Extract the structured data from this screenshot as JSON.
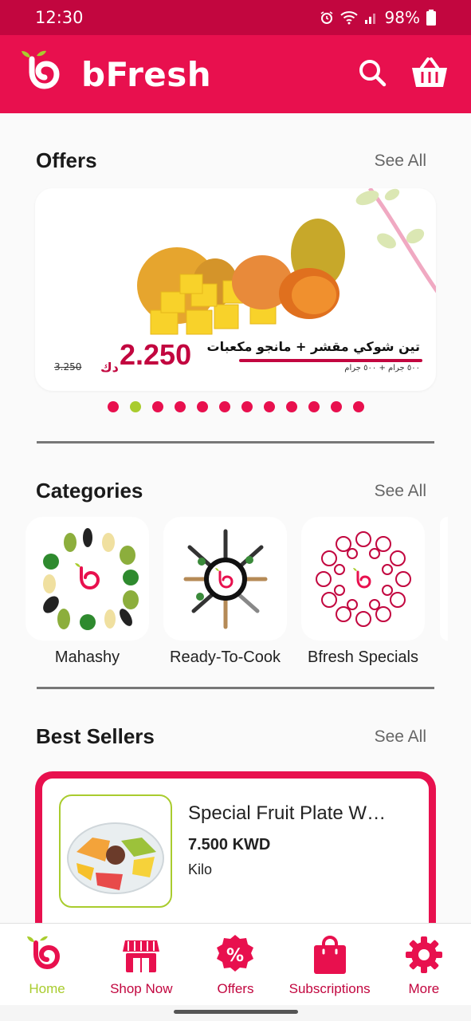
{
  "status_bar": {
    "time": "12:30",
    "battery": "98%"
  },
  "app_bar": {
    "brand_name": "bFresh",
    "search_icon": "search-icon",
    "cart_icon": "basket-icon"
  },
  "offers": {
    "title": "Offers",
    "see_all": "See All",
    "banner": {
      "title_ar": "تين شوكي مقشر + مانجو مكعبات",
      "subtitle_ar": "٥٠٠ جرام + ٥٠٠ جرام",
      "price": "2.250",
      "currency": "دك",
      "old_price": "3.250"
    },
    "dots_count": 12,
    "active_dot": 1
  },
  "categories": {
    "title": "Categories",
    "see_all": "See All",
    "items": [
      {
        "label": "Mahashy"
      },
      {
        "label": "Ready-To-Cook"
      },
      {
        "label": "Bfresh Specials"
      }
    ]
  },
  "best_sellers": {
    "title": "Best Sellers",
    "see_all": "See All",
    "items": [
      {
        "name": "Special Fruit Plate W…",
        "price": "7.500 KWD",
        "unit": "Kilo"
      }
    ]
  },
  "bottom_nav": {
    "items": [
      {
        "label": "Home",
        "icon": "home-logo-icon",
        "active": true
      },
      {
        "label": "Shop Now",
        "icon": "shop-icon",
        "active": false
      },
      {
        "label": "Offers",
        "icon": "offers-badge-icon",
        "active": false
      },
      {
        "label": "Subscriptions",
        "icon": "bag-icon",
        "active": false
      },
      {
        "label": "More",
        "icon": "gear-icon",
        "active": false
      }
    ]
  },
  "colors": {
    "primary": "#e8104e",
    "primary_dark": "#c2063f",
    "accent": "#a9cc2e"
  }
}
